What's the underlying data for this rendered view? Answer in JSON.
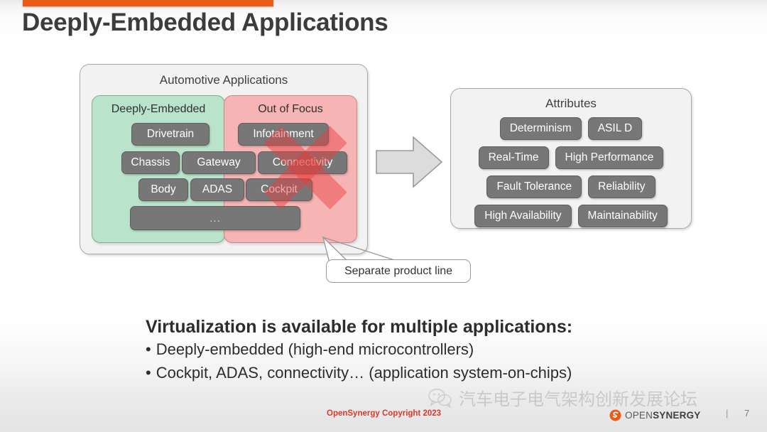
{
  "slide": {
    "title": "Deeply-Embedded Applications",
    "accent_color": "#ea5b16"
  },
  "diagram": {
    "outer_title": "Automotive Applications",
    "panels": [
      {
        "id": "deeply-embedded",
        "title": "Deeply-Embedded",
        "color": "#b9e3ca",
        "chips": [
          "Drivetrain",
          "Chassis",
          "Gateway",
          "Body",
          "ADAS"
        ]
      },
      {
        "id": "out-of-focus",
        "title": "Out of Focus",
        "color": "#f6b4b4",
        "crossed_out": true,
        "chips": [
          "Infotainment",
          "Connectivity",
          "Cockpit"
        ]
      }
    ],
    "chips": {
      "drivetrain": "Drivetrain",
      "chassis": "Chassis",
      "gateway": "Gateway",
      "body": "Body",
      "adas": "ADAS",
      "infotainment": "Infotainment",
      "connectivity": "Connectivity",
      "cockpit": "Cockpit",
      "ellipsis": "..."
    },
    "callout": "Separate product line",
    "arrow": "right-arrow"
  },
  "attributes": {
    "title": "Attributes",
    "rows": [
      [
        "Determinism",
        "ASIL D"
      ],
      [
        "Real-Time",
        "High Performance"
      ],
      [
        "Fault Tolerance",
        "Reliability"
      ],
      [
        "High Availability",
        "Maintainability"
      ]
    ],
    "items": {
      "r0c0": "Determinism",
      "r0c1": "ASIL D",
      "r1c0": "Real-Time",
      "r1c1": "High Performance",
      "r2c0": "Fault Tolerance",
      "r2c1": "Reliability",
      "r3c0": "High Availability",
      "r3c1": "Maintainability"
    }
  },
  "body": {
    "heading": "Virtualization is available for multiple applications:",
    "bullets": [
      "Deeply-embedded (high-end microcontrollers)",
      "Cockpit, ADAS, connectivity… (application system-on-chips)"
    ],
    "bullet_1": "Deeply-embedded (high-end microcontrollers)",
    "bullet_2": "Cockpit, ADAS, connectivity… (application system-on-chips)",
    "bullet_glyph": "•"
  },
  "watermark": {
    "text": "汽车电子电气架构创新发展论坛",
    "icon": "wechat-icon"
  },
  "footer": {
    "copyright": "OpenSynergy Copyright 2023",
    "copyright_color": "#d93a2b",
    "logo_open": "OPEN",
    "logo_synergy": "SYNERGY",
    "separator": "|",
    "page_number": "7"
  }
}
